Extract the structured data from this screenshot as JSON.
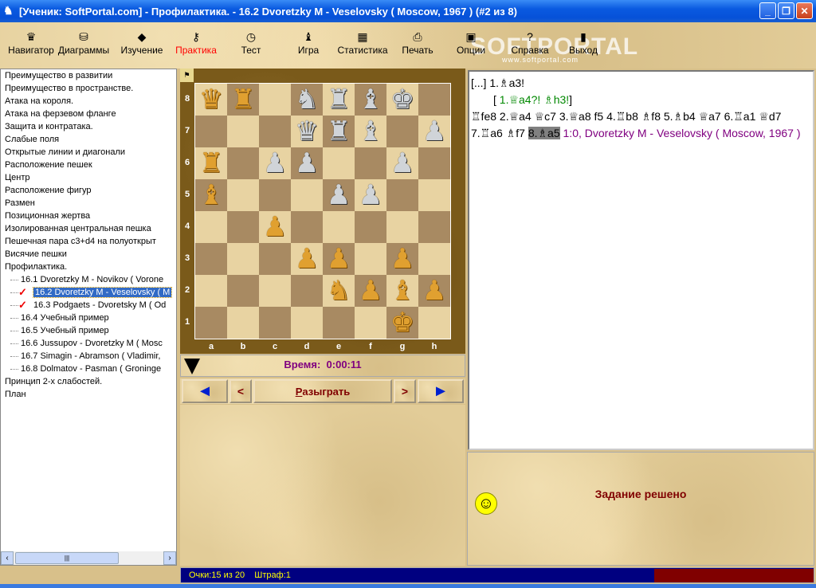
{
  "window": {
    "title": "[Ученик: SoftPortal.com] - Профилактика. - 16.2 Dvoretzky M - Veselovsky ( Moscow, 1967 ) (#2 из 8)",
    "minimize": "_",
    "maximize": "❐",
    "close": "✕"
  },
  "toolbar": [
    {
      "label": "Навигатор",
      "icon": "♛"
    },
    {
      "label": "Диаграммы",
      "icon": "⛁"
    },
    {
      "label": "Изучение",
      "icon": "◆"
    },
    {
      "label": "Практика",
      "icon": "⚷"
    },
    {
      "label": "Тест",
      "icon": "◷"
    },
    {
      "label": "Игра",
      "icon": "♝"
    },
    {
      "label": "Статистика",
      "icon": "▦"
    },
    {
      "label": "Печать",
      "icon": "⎙"
    },
    {
      "label": "Опции",
      "icon": "▣"
    },
    {
      "label": "Справка",
      "icon": "?"
    },
    {
      "label": "Выход",
      "icon": "▮"
    }
  ],
  "watermark": {
    "text": "SOFTPORTAL",
    "url": "www.softportal.com"
  },
  "tree": {
    "items": [
      "Преимущество в развитии",
      "Преимущество в пространстве.",
      "Атака на короля.",
      "Атака на ферзевом фланге",
      "Защита и контратака.",
      "Слабые поля",
      "Открытые линии и диагонали",
      "Расположение пешек",
      "Центр",
      "Расположение фигур",
      "Размен",
      "Позиционная жертва",
      "Изолированная центральная пешка",
      "Пешечная пара c3+d4 на полуоткрыт",
      "Висячие пешки",
      "Профилактика."
    ],
    "subitems": [
      {
        "label": "16.1 Dvoretzky M - Novikov ( Vorone",
        "check": false,
        "selected": false
      },
      {
        "label": "16.2 Dvoretzky M - Veselovsky ( M",
        "check": true,
        "selected": true
      },
      {
        "label": "16.3 Podgaets - Dvoretsky M ( Od",
        "check": true,
        "selected": false
      },
      {
        "label": "16.4 Учебный пример",
        "check": false,
        "selected": false
      },
      {
        "label": "16.5 Учебный пример",
        "check": false,
        "selected": false
      },
      {
        "label": "16.6 Jussupov - Dvoretzky M ( Mosc",
        "check": false,
        "selected": false
      },
      {
        "label": "16.7 Simagin - Abramson ( Vladimir,",
        "check": false,
        "selected": false
      },
      {
        "label": "16.8 Dolmatov - Pasman ( Groninge",
        "check": false,
        "selected": false
      }
    ],
    "after": [
      "Принцип 2-х слабостей.",
      "План"
    ]
  },
  "board": {
    "rows": [
      "QR.nrbk.",
      "...qrb.p",
      "R.pp..p.",
      "B...pp..",
      "..P.....",
      "...PP.P.",
      "....NPBP",
      "......K."
    ],
    "ranks": [
      "8",
      "7",
      "6",
      "5",
      "4",
      "3",
      "2",
      "1"
    ],
    "files": [
      "a",
      "b",
      "c",
      "d",
      "e",
      "f",
      "g",
      "h"
    ]
  },
  "time": {
    "label": "Время:",
    "value": "0:00:11"
  },
  "nav": {
    "first": "◄",
    "prev": "<",
    "play_u": "Р",
    "play_rest": "азыграть",
    "next": ">",
    "last": "►"
  },
  "notation": {
    "l1": "[...] 1.♗a3!",
    "var_open": "[ ",
    "var": "1.♕a4?! ♗h3!",
    "var_close": "]",
    "main": "♖fe8 2.♕a4 ♕c7 3.♕a8 f5 4.♖b8 ♗f8 5.♗b4 ♕a7 6.♖a1 ♕d7 7.♖a6 ♗f7 ",
    "current": "8.♗a5",
    "result": " 1:0, Dvoretzky M - Veselovsky ( Moscow, 1967 )"
  },
  "result": {
    "message": "Задание решено",
    "smiley": "☺"
  },
  "status": {
    "text": "Очки:15 из 20    Штраф:1"
  }
}
